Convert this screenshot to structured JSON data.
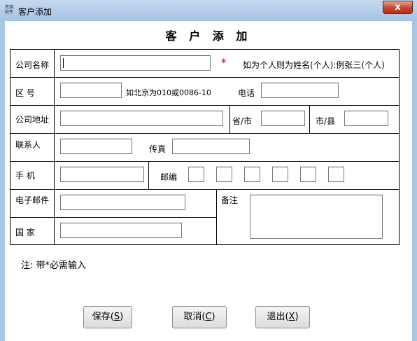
{
  "window": {
    "title": "客户添加",
    "icon_text": "资源 软件",
    "close_label": "x"
  },
  "form": {
    "heading": "客 户 添 加",
    "labels": {
      "company": "公司名称",
      "area": "区  号",
      "area_hint": "如北京为010或0086-10",
      "phone": "电话",
      "address": "公司地址",
      "province": "省/市",
      "city": "市/县",
      "contact": "联系人",
      "fax": "传真",
      "mobile": "手  机",
      "postcode": "邮编",
      "email": "电子邮件",
      "remark": "备注",
      "country": "国  家"
    },
    "required_mark": "*",
    "company_hint": "如为个人则为姓名(个人):例张三(个人)",
    "values": {
      "company": "",
      "area": "",
      "phone": "",
      "address": "",
      "province": "",
      "city": "",
      "contact": "",
      "fax": "",
      "mobile": "",
      "email": "",
      "country": "",
      "remark": "",
      "postcode": [
        "",
        "",
        "",
        "",
        "",
        ""
      ]
    }
  },
  "note": "注: 带*必需输入",
  "buttons": {
    "save": "保存",
    "save_key": "S",
    "cancel": "取消",
    "cancel_key": "C",
    "exit": "退出",
    "exit_key": "X"
  }
}
